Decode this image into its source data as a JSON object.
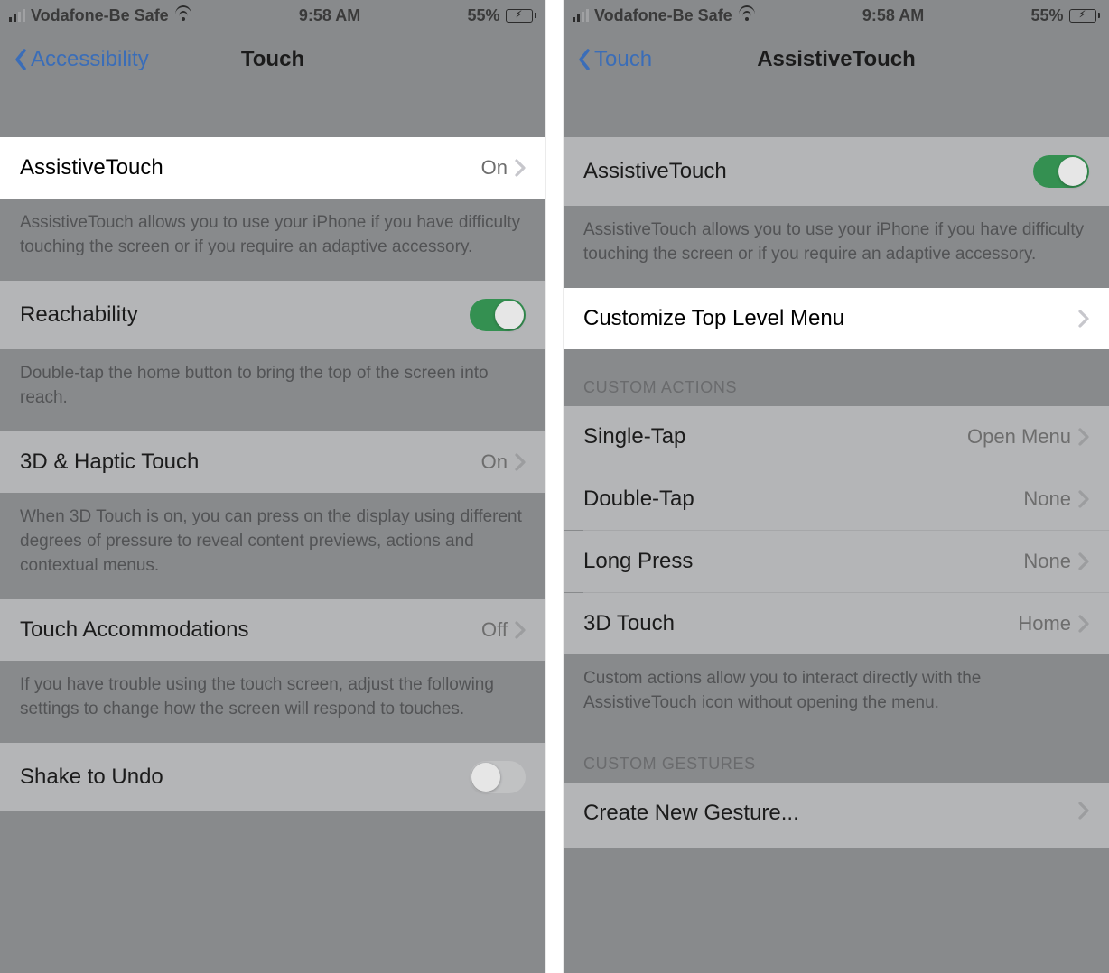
{
  "statusbar": {
    "carrier": "Vodafone-Be Safe",
    "time": "9:58 AM",
    "battery_pct": "55%"
  },
  "left": {
    "nav": {
      "back": "Accessibility",
      "title": "Touch"
    },
    "assistive": {
      "label": "AssistiveTouch",
      "value": "On"
    },
    "assistive_footer": "AssistiveTouch allows you to use your iPhone if you have difficulty touching the screen or if you require an adaptive accessory.",
    "reachability": {
      "label": "Reachability"
    },
    "reachability_footer": "Double-tap the home button to bring the top of the screen into reach.",
    "haptic": {
      "label": "3D & Haptic Touch",
      "value": "On"
    },
    "haptic_footer": "When 3D Touch is on, you can press on the display using different degrees of pressure to reveal content previews, actions and contextual menus.",
    "touchacc": {
      "label": "Touch Accommodations",
      "value": "Off"
    },
    "touchacc_footer": "If you have trouble using the touch screen, adjust the following settings to change how the screen will respond to touches.",
    "shake": {
      "label": "Shake to Undo"
    }
  },
  "right": {
    "nav": {
      "back": "Touch",
      "title": "AssistiveTouch"
    },
    "assistive": {
      "label": "AssistiveTouch"
    },
    "assistive_footer": "AssistiveTouch allows you to use your iPhone if you have difficulty touching the screen or if you require an adaptive accessory.",
    "customize": {
      "label": "Customize Top Level Menu"
    },
    "header_custom_actions": "CUSTOM ACTIONS",
    "single": {
      "label": "Single-Tap",
      "value": "Open Menu"
    },
    "double": {
      "label": "Double-Tap",
      "value": "None"
    },
    "long": {
      "label": "Long Press",
      "value": "None"
    },
    "threeD": {
      "label": "3D Touch",
      "value": "Home"
    },
    "actions_footer": "Custom actions allow you to interact directly with the AssistiveTouch icon without opening the menu.",
    "header_custom_gestures": "CUSTOM GESTURES",
    "create": {
      "label": "Create New Gesture..."
    }
  }
}
